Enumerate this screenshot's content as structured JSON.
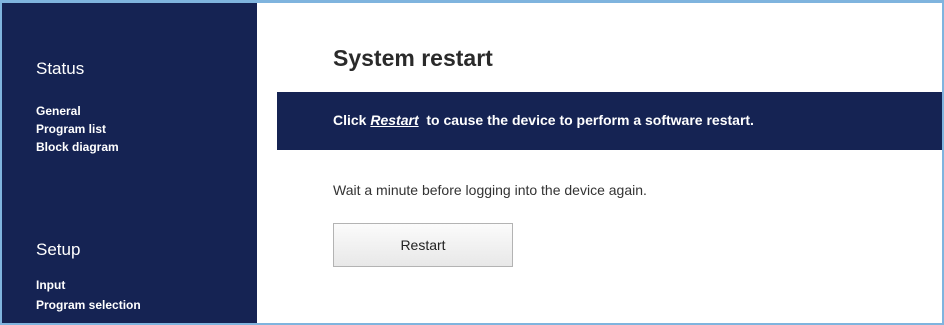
{
  "sidebar": {
    "status": {
      "title": "Status",
      "items": [
        {
          "label": "General"
        },
        {
          "label": "Program list"
        },
        {
          "label": "Block diagram"
        }
      ]
    },
    "setup": {
      "title": "Setup",
      "items": [
        {
          "label": "Input"
        },
        {
          "label": "Program selection"
        }
      ]
    }
  },
  "main": {
    "title": "System restart",
    "info": {
      "prefix": "Click ",
      "link": "Restart",
      "suffix": "  to cause the device to perform a software restart."
    },
    "description": "Wait a minute before logging into the device again.",
    "restart_button": "Restart"
  },
  "colors": {
    "sidebar_bg": "#152353",
    "info_bar_bg": "#152353",
    "frame_border": "#7fb4de"
  }
}
